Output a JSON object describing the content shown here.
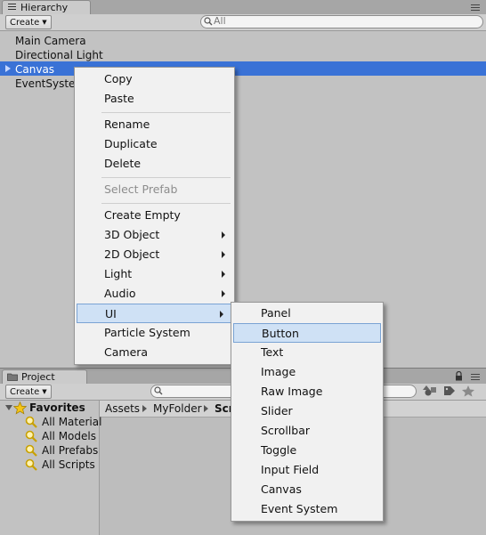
{
  "hierarchy": {
    "tab_title": "Hierarchy",
    "create_label": "Create",
    "search_placeholder": "All",
    "items": [
      "Main Camera",
      "Directional Light",
      "Canvas",
      "EventSyste"
    ]
  },
  "context_menu": {
    "groups": [
      [
        "Copy",
        "Paste"
      ],
      [
        "Rename",
        "Duplicate",
        "Delete"
      ],
      [
        "Select Prefab"
      ],
      [
        "Create Empty",
        "3D Object",
        "2D Object",
        "Light",
        "Audio",
        "UI",
        "Particle System",
        "Camera"
      ]
    ],
    "disabled": [
      "Select Prefab"
    ],
    "has_submenu": [
      "3D Object",
      "2D Object",
      "Light",
      "Audio",
      "UI"
    ],
    "open_item": "UI"
  },
  "ui_submenu": {
    "items": [
      "Panel",
      "Button",
      "Text",
      "Image",
      "Raw Image",
      "Slider",
      "Scrollbar",
      "Toggle",
      "Input Field",
      "Canvas",
      "Event System"
    ],
    "highlighted": "Button"
  },
  "project": {
    "tab_title": "Project",
    "create_label": "Create",
    "favorites_label": "Favorites",
    "favorites": [
      "All Material",
      "All Models",
      "All Prefabs",
      "All Scripts"
    ],
    "breadcrumb": [
      "Assets",
      "MyFolder",
      "Scr"
    ]
  },
  "colors": {
    "selection": "#3a72d6",
    "menu_highlight": "#cfe1f5",
    "menu_highlight_border": "#7aa3d4"
  },
  "icons": {
    "hierarchy_tab": "list-icon",
    "project_tab": "folder-icon",
    "search": "search-icon",
    "favorite_search": "saved-search-icon",
    "favorites": "star-icon",
    "lock": "lock-icon",
    "panel_menu": "panel-menu-icon"
  }
}
